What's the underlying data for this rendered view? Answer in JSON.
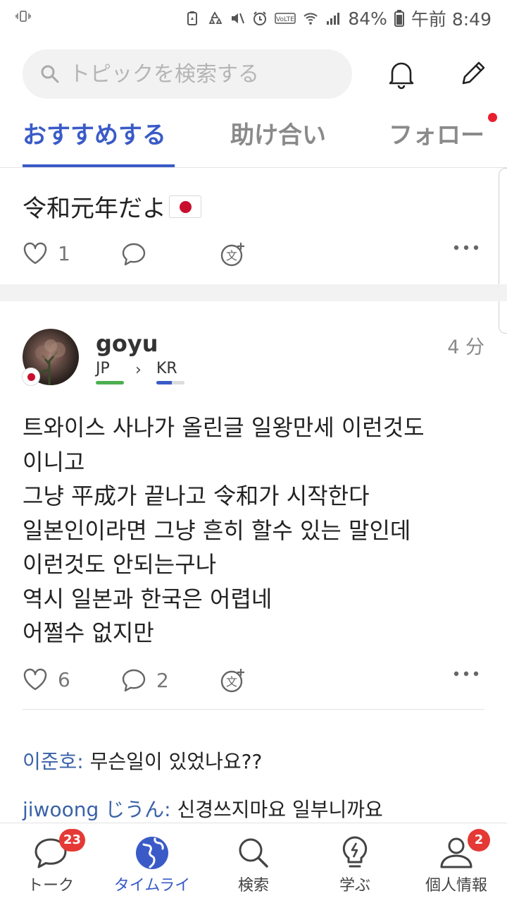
{
  "status_bar": {
    "battery": "84%",
    "time": "午前 8:49",
    "icons": [
      "notification-vibrate-icon",
      "battery-saver-icon",
      "recycle-icon",
      "mute-icon",
      "alarm-icon",
      "volte-icon",
      "wifi-icon",
      "signal-icon",
      "battery-icon"
    ]
  },
  "search": {
    "placeholder": "トピックを検索する"
  },
  "tabs": [
    {
      "label": "おすすめする",
      "active": true
    },
    {
      "label": "助け合い",
      "active": false
    },
    {
      "label": "フォロー",
      "active": false
    }
  ],
  "post1": {
    "text": "令和元年だよ",
    "likes": "1"
  },
  "post2": {
    "username": "goyu",
    "time": "4 分",
    "native_lang": "JP",
    "learning_lang": "KR",
    "native_level": 1.0,
    "learning_level": 0.55,
    "body": [
      "트와이스 사나가 올린글 일왕만세 이런것도",
      "이니고",
      "그냥 平成가 끝나고 令和가 시작한다",
      "일본인이라면 그냥 흔히 할수 있는 말인데",
      "이런것도 안되는구나",
      "역시 일본과 한국은 어렵네",
      "어쩔수 없지만"
    ],
    "likes": "6",
    "comments": "2"
  },
  "comments": [
    {
      "author": "이준호:",
      "text": "무슨일이 있었나요??"
    },
    {
      "author": "jiwoong じうん:",
      "text": "신경쓰지마요 일부니까요"
    }
  ],
  "bottom_nav": [
    {
      "label": "トーク",
      "badge": "23",
      "icon": "chat-bubble-icon"
    },
    {
      "label": "タイムライ",
      "badge": "",
      "icon": "globe-icon",
      "active": true
    },
    {
      "label": "検索",
      "badge": "",
      "icon": "search-icon"
    },
    {
      "label": "学ぶ",
      "badge": "",
      "icon": "lightbulb-icon"
    },
    {
      "label": "個人情報",
      "badge": "2",
      "icon": "profile-icon"
    }
  ],
  "colors": {
    "accent": "#3a5bc7",
    "badge": "#e53935",
    "comment_author": "#3a62a8",
    "native_bar": "#4caf50",
    "learning_bar": "#3a5bc7"
  }
}
